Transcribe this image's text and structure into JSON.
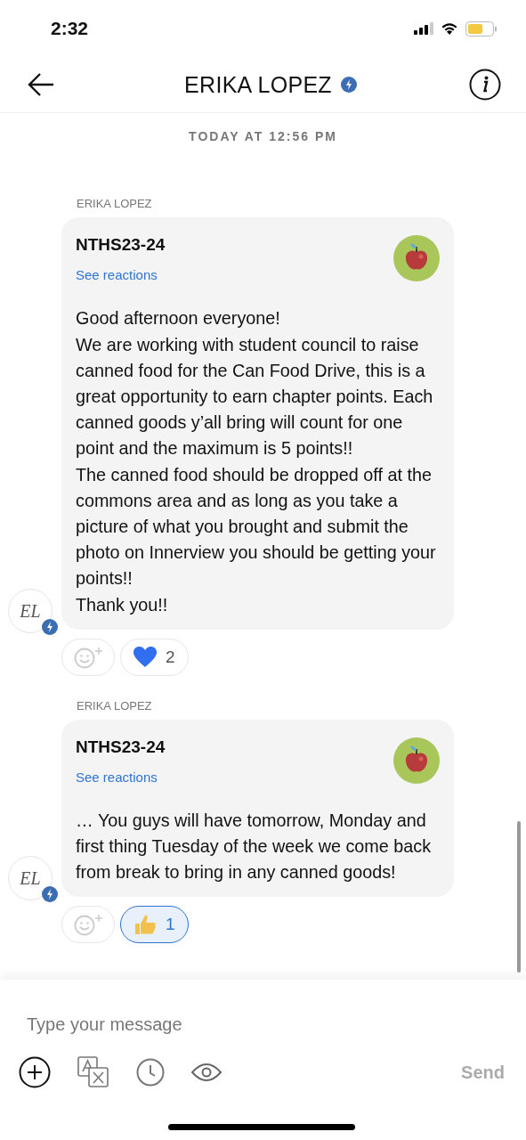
{
  "status_bar": {
    "time": "2:32"
  },
  "header": {
    "title": "ERIKA LOPEZ",
    "verified": true
  },
  "timestamp": "TODAY AT 12:56 PM",
  "messages": [
    {
      "sender": "ERIKA LOPEZ",
      "avatar": "EL",
      "group": "NTHS23-24",
      "link": "See reactions",
      "paragraphs": [
        "Good afternoon everyone!",
        "We are working with student council to raise canned food for the Can Food Drive, this is a great opportunity  to earn chapter points. Each canned goods y’all bring will count for one point and the maximum is 5 points!!",
        "The canned food should be dropped off at the commons area and as long as you take a picture of what you brought and submit the photo on Innerview you should be getting your points!!",
        "Thank you!!"
      ],
      "reactions": [
        {
          "kind": "heart",
          "count": "2",
          "selected": false
        }
      ]
    },
    {
      "sender": "ERIKA LOPEZ",
      "avatar": "EL",
      "group": "NTHS23-24",
      "link": "See reactions",
      "paragraphs": [
        "… You guys will have tomorrow, Monday and first thing Tuesday of the week we come back from break to bring in any canned goods!"
      ],
      "reactions": [
        {
          "kind": "thumbs",
          "count": "1",
          "selected": true
        }
      ]
    }
  ],
  "composer": {
    "placeholder": "Type your message",
    "send": "Send"
  }
}
